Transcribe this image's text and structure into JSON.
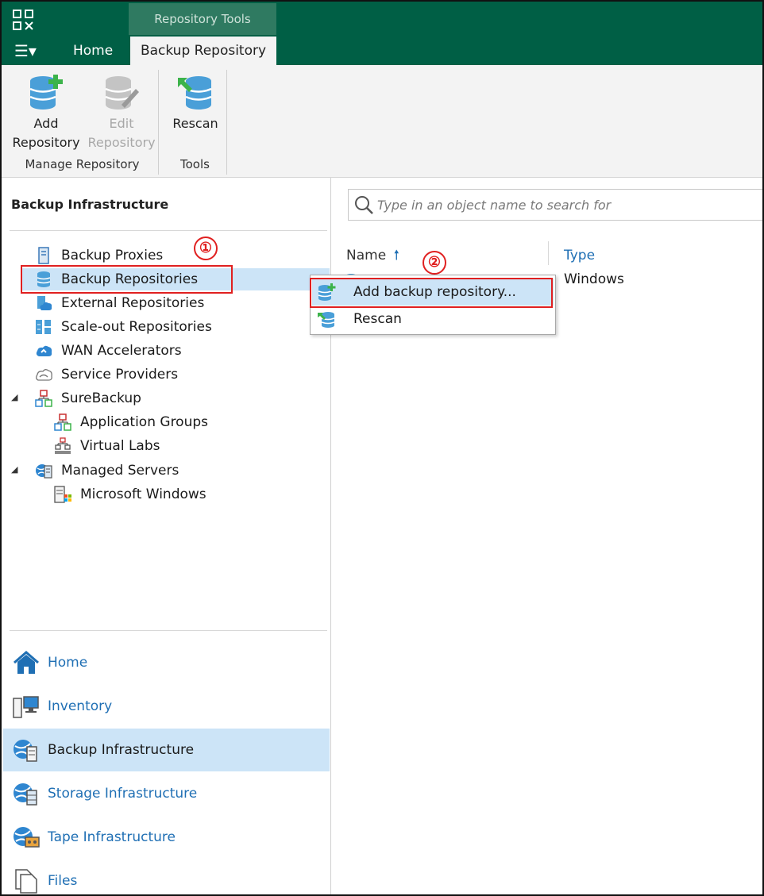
{
  "ribbon": {
    "context_group": "Repository Tools",
    "menu_label": "☰▾",
    "tabs": [
      {
        "label": "Home"
      },
      {
        "label": "Backup Repository"
      }
    ],
    "groups": [
      {
        "label": "Manage Repository",
        "buttons": [
          {
            "label_line1": "Add",
            "label_line2": "Repository",
            "icon": "add-repository-icon",
            "enabled": true
          },
          {
            "label_line1": "Edit",
            "label_line2": "Repository",
            "icon": "edit-repository-icon",
            "enabled": false
          }
        ]
      },
      {
        "label": "Tools",
        "buttons": [
          {
            "label_line1": "Rescan",
            "icon": "rescan-icon",
            "enabled": true
          }
        ]
      }
    ]
  },
  "left_panel": {
    "title": "Backup Infrastructure",
    "tree": [
      {
        "label": "Backup Proxies",
        "icon": "backup-proxy-icon"
      },
      {
        "label": "Backup Repositories",
        "icon": "repository-icon",
        "selected": true
      },
      {
        "label": "External Repositories",
        "icon": "external-repository-icon"
      },
      {
        "label": "Scale-out Repositories",
        "icon": "scaleout-repository-icon"
      },
      {
        "label": "WAN Accelerators",
        "icon": "wan-accelerator-icon"
      },
      {
        "label": "Service Providers",
        "icon": "service-provider-icon"
      },
      {
        "label": "SureBackup",
        "icon": "surebackup-icon",
        "expanded": true
      },
      {
        "label": "Application Groups",
        "icon": "application-group-icon"
      },
      {
        "label": "Virtual Labs",
        "icon": "virtual-lab-icon"
      },
      {
        "label": "Managed Servers",
        "icon": "managed-servers-icon",
        "expanded": true
      },
      {
        "label": "Microsoft Windows",
        "icon": "windows-server-icon"
      }
    ],
    "nav": [
      {
        "label": "Home",
        "icon": "home-icon"
      },
      {
        "label": "Inventory",
        "icon": "inventory-icon"
      },
      {
        "label": "Backup Infrastructure",
        "icon": "backup-infrastructure-icon",
        "active": true
      },
      {
        "label": "Storage Infrastructure",
        "icon": "storage-infrastructure-icon"
      },
      {
        "label": "Tape Infrastructure",
        "icon": "tape-infrastructure-icon"
      },
      {
        "label": "Files",
        "icon": "files-icon"
      }
    ]
  },
  "main": {
    "search_placeholder": "Type in an object name to search for",
    "columns": [
      {
        "label": "Name",
        "sort": "ascending"
      },
      {
        "label": "Type"
      }
    ],
    "rows": [
      {
        "type": "Windows"
      }
    ]
  },
  "context_menu": {
    "items": [
      {
        "label": "Add backup repository...",
        "icon": "add-repository-icon",
        "highlighted": true
      },
      {
        "label": "Rescan",
        "icon": "rescan-icon"
      }
    ]
  },
  "annotations": {
    "step1": "①",
    "step2": "②",
    "color": "#e02020"
  },
  "colors": {
    "titlebar": "#005f45",
    "accent_blue": "#1f6fb4",
    "selection": "#cce4f7"
  }
}
